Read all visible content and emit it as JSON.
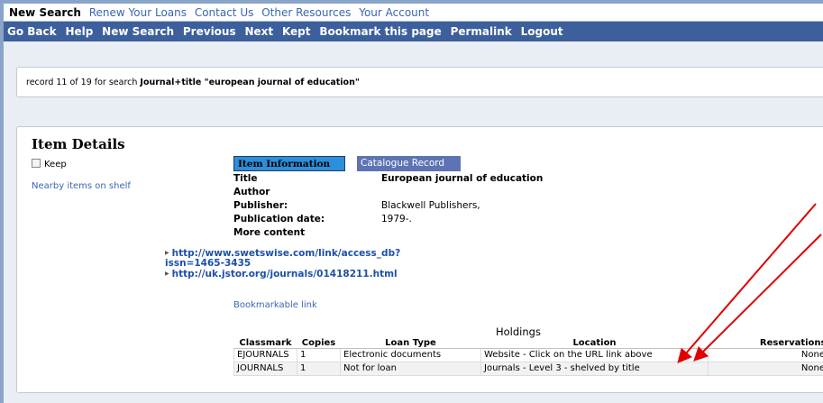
{
  "topnav": {
    "items": [
      "New Search",
      "Renew Your Loans",
      "Contact Us",
      "Other Resources",
      "Your Account"
    ]
  },
  "toolbar": {
    "items": [
      "Go Back",
      "Help",
      "New Search",
      "Previous",
      "Next",
      "Kept",
      "Bookmark this page",
      "Permalink",
      "Logout"
    ]
  },
  "record": {
    "prefix": "record 11 of 19 for search ",
    "query": "Journal+title \"european journal of education\""
  },
  "details": {
    "heading": "Item Details",
    "keep_label": "Keep",
    "nearby_link": "Nearby items on shelf",
    "tab_item_info": "Item Information",
    "tab_catalogue": "Catalogue Record",
    "fields": {
      "title_label": "Title",
      "title_value": "European journal of education",
      "author_label": "Author",
      "publisher_label": "Publisher:",
      "publisher_value": "Blackwell Publishers,",
      "pubdate_label": "Publication date:",
      "pubdate_value": "1979-.",
      "more_label": "More content"
    },
    "links": [
      "http://www.swetswise.com/link/access_db?",
      "issn=1465-3435",
      "http://uk.jstor.org/journals/01418211.html"
    ],
    "bookmarkable": "Bookmarkable link"
  },
  "holdings": {
    "title": "Holdings",
    "headers": [
      "Classmark",
      "Copies",
      "Loan Type",
      "Location",
      "Reservations"
    ],
    "rows": [
      [
        "EJOURNALS",
        "1",
        "Electronic documents",
        "Website - Click on the URL link above",
        "None"
      ],
      [
        "JOURNALS",
        "1",
        "Not for loan",
        "Journals - Level 3 - shelved by title",
        "None"
      ]
    ]
  },
  "colors": {
    "toolbar_bg": "#3d5f9c",
    "link": "#3a65b3",
    "active_tab": "#2d8fd9",
    "annotation_arrow": "#e00000"
  }
}
